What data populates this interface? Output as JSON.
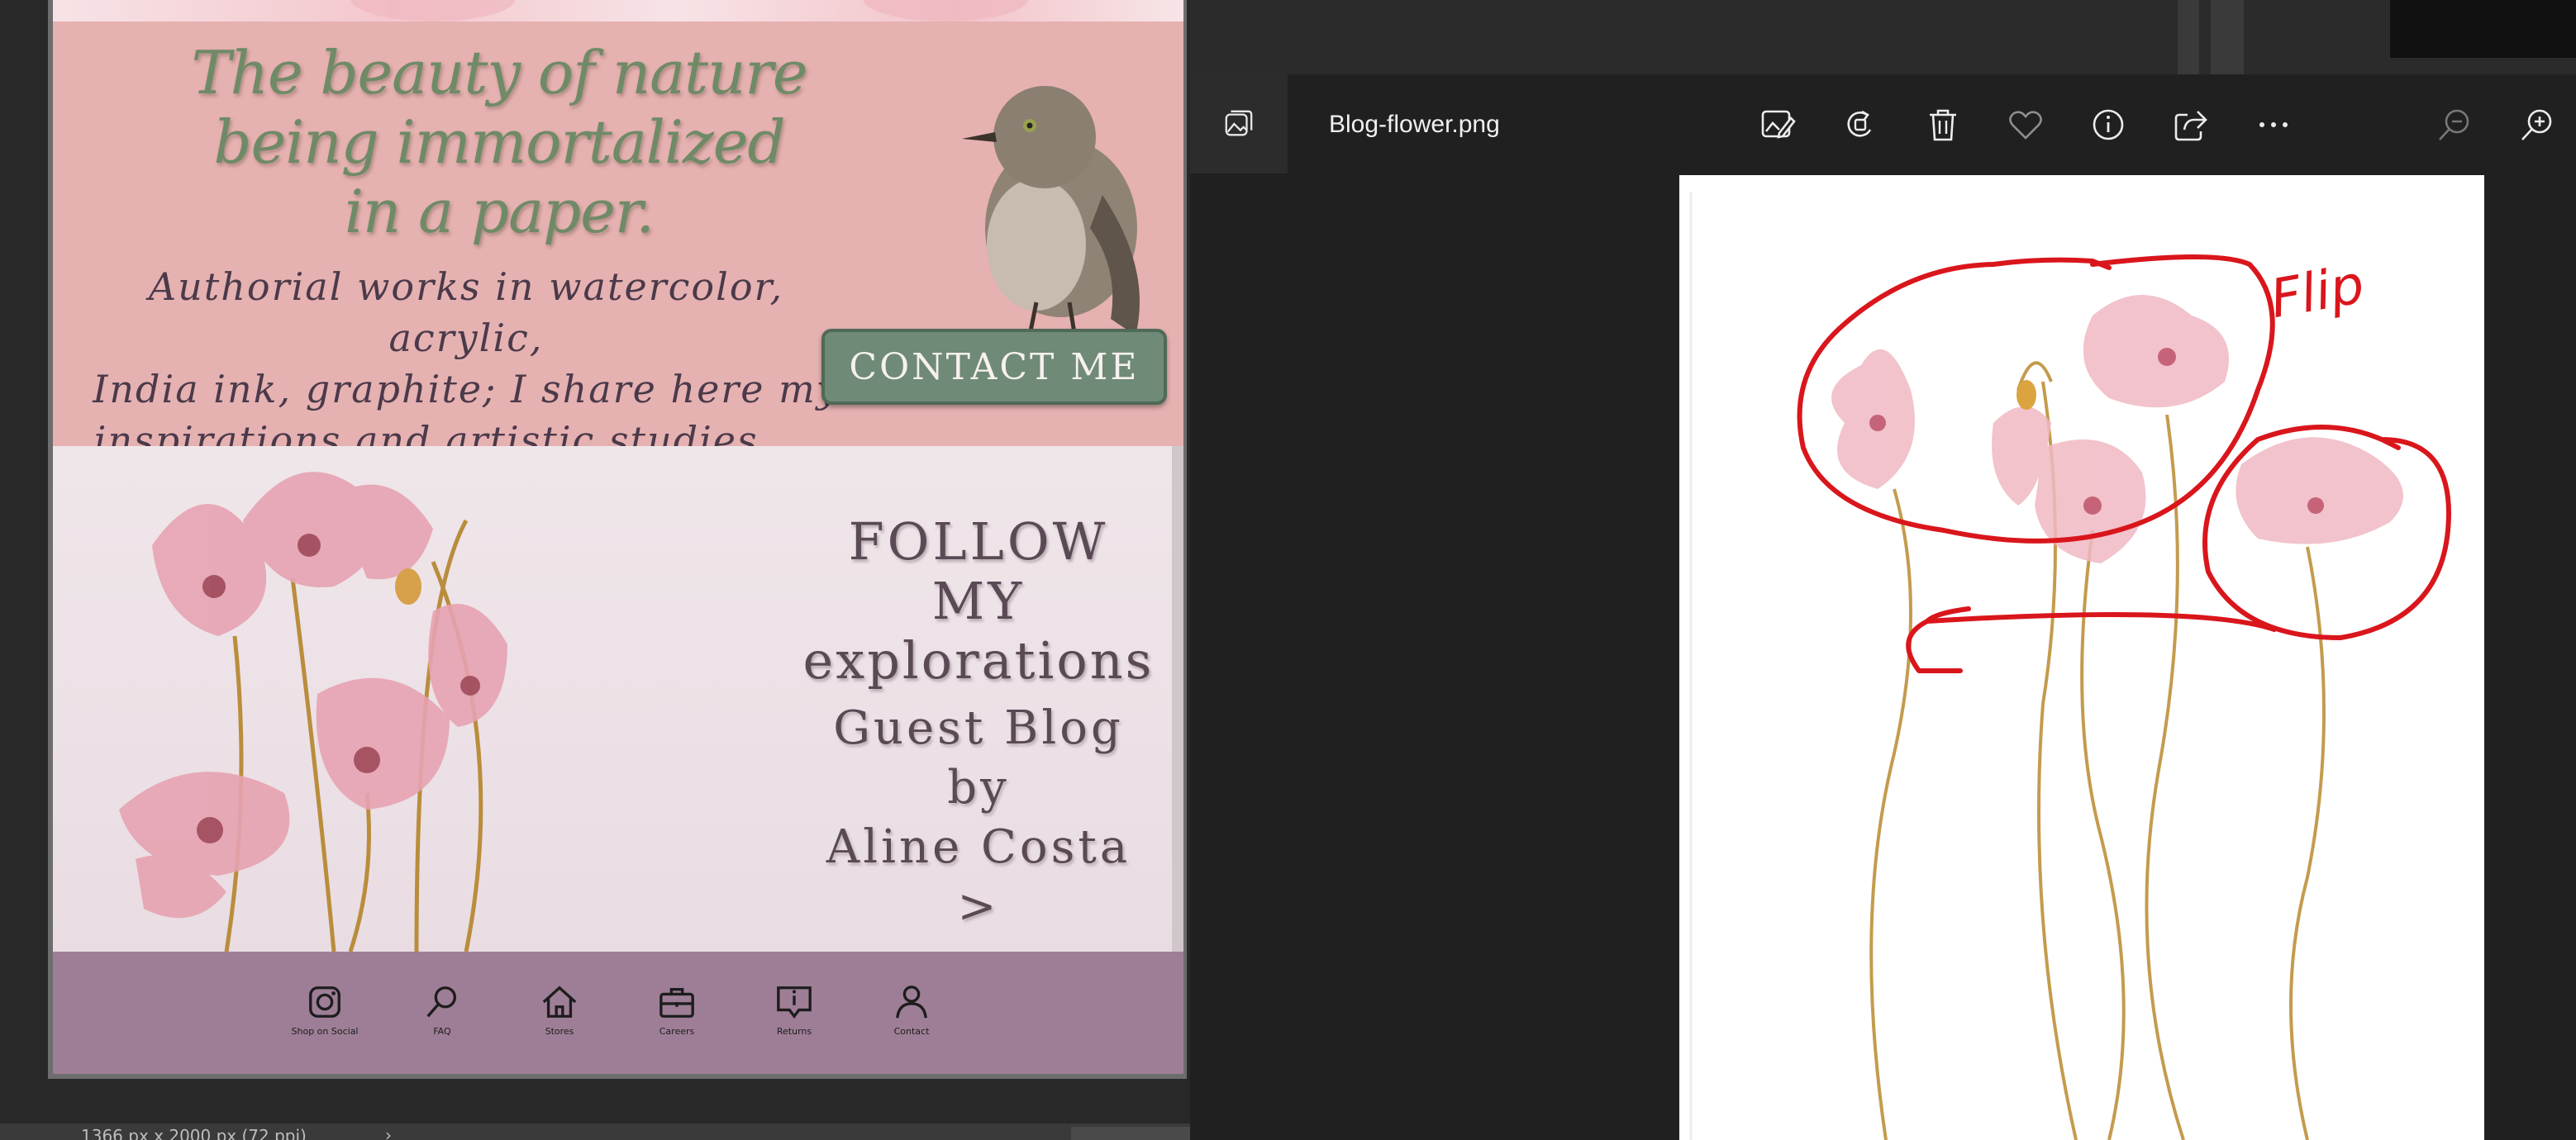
{
  "editor": {
    "hero": {
      "title_lines": [
        "The beauty of nature",
        "being immortalized",
        "in a paper."
      ],
      "subtitle_lines": [
        "Authorial works in watercolor, acrylic,",
        "India ink, graphite; I share here my",
        "inspirations and artistic studies."
      ],
      "contact_label": "CONTACT ME"
    },
    "follow": {
      "heading_line1": "FOLLOW MY",
      "heading_line2": "explorations",
      "guest_line1": "Guest Blog by",
      "guest_line2": "Aline Costa >"
    },
    "footer_nav": [
      {
        "label": "Shop on Social",
        "icon": "instagram-icon"
      },
      {
        "label": "FAQ",
        "icon": "search-icon"
      },
      {
        "label": "Stores",
        "icon": "home-icon"
      },
      {
        "label": "Careers",
        "icon": "briefcase-icon"
      },
      {
        "label": "Returns",
        "icon": "info-chat-icon"
      },
      {
        "label": "Contact",
        "icon": "person-icon"
      }
    ],
    "status": {
      "dimensions": "1366 px x 2000 px (72 ppi)",
      "arrow": "›"
    }
  },
  "viewer": {
    "file_name": "Blog-flower.png",
    "toolbar": [
      {
        "name": "edit-image-button",
        "icon": "edit-image-icon"
      },
      {
        "name": "rotate-button",
        "icon": "rotate-icon"
      },
      {
        "name": "delete-button",
        "icon": "trash-icon"
      },
      {
        "name": "favorite-button",
        "icon": "heart-icon"
      },
      {
        "name": "info-button",
        "icon": "info-icon"
      },
      {
        "name": "share-button",
        "icon": "share-icon"
      },
      {
        "name": "more-button",
        "icon": "more-icon"
      },
      {
        "name": "zoom-out-button",
        "icon": "zoom-out-icon"
      },
      {
        "name": "zoom-in-button",
        "icon": "zoom-in-icon"
      }
    ],
    "annotation": "Flip",
    "colors": {
      "annotation": "#d9161c",
      "viewer_bg": "#202020",
      "hero_bg": "#e6b1b1",
      "footer_bg": "#9e7e96",
      "button_bg": "#6f8a76"
    }
  }
}
